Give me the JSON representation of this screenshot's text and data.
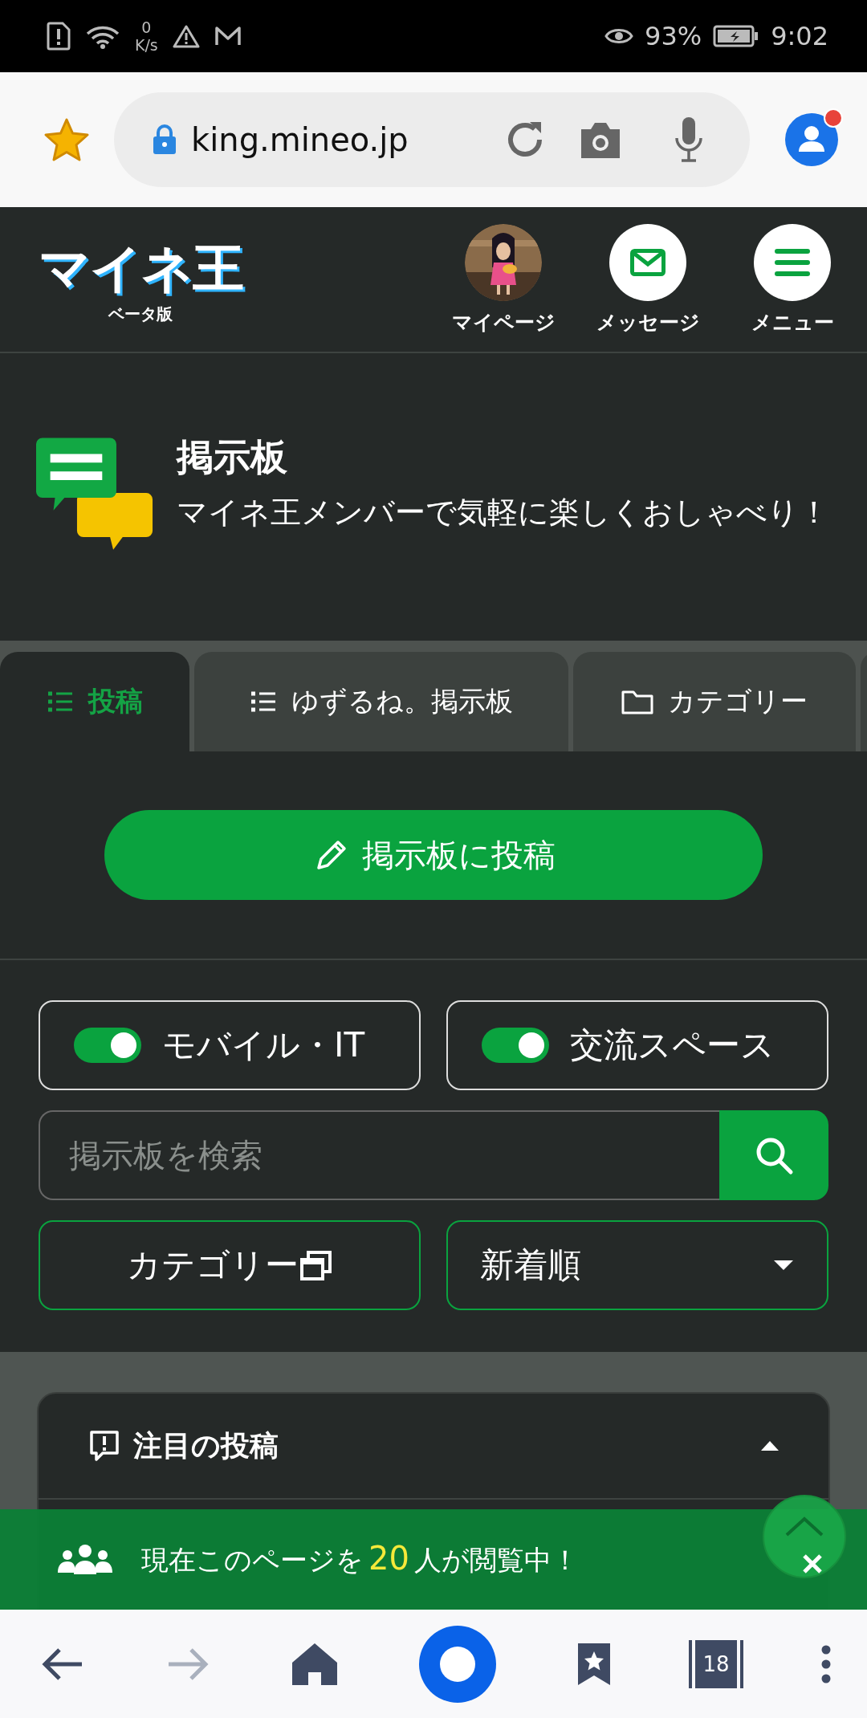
{
  "status_bar": {
    "net_speed": "0",
    "net_unit": "K/s",
    "battery": "93%",
    "time": "9:02"
  },
  "browser": {
    "url": "king.mineo.jp",
    "notification": true
  },
  "site_header": {
    "logo": "マイネ王",
    "logo_sub": "ベータ版",
    "nav": [
      {
        "label": "マイページ",
        "kind": "avatar"
      },
      {
        "label": "メッセージ",
        "kind": "mail"
      },
      {
        "label": "メニュー",
        "kind": "menu"
      }
    ]
  },
  "board": {
    "title": "掲示板",
    "subtitle": "マイネ王メンバーで気軽に楽しくおしゃべり！"
  },
  "tabs": [
    {
      "label": "投稿",
      "kind": "list",
      "selected": true
    },
    {
      "label": "ゆずるね。掲示板",
      "kind": "list",
      "selected": false
    },
    {
      "label": "カテゴリー",
      "kind": "folder",
      "selected": false
    }
  ],
  "post_button": "掲示板に投稿",
  "filters": [
    {
      "label": "モバイル・IT",
      "on": true
    },
    {
      "label": "交流スペース",
      "on": true
    }
  ],
  "search": {
    "placeholder": "掲示板を検索"
  },
  "category_button": "カテゴリー",
  "sort": {
    "value": "新着順"
  },
  "featured": {
    "title": "注目の投稿",
    "expanded": true
  },
  "viewer_banner": {
    "before": "現在このページを",
    "count": "20",
    "after": "人が閲覧中！"
  },
  "bottom_nav": {
    "tab_count": "18"
  }
}
